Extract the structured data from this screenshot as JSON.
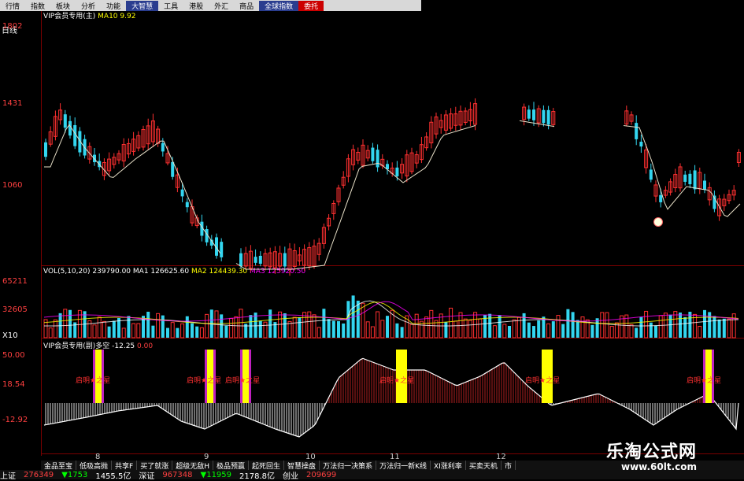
{
  "menu": [
    {
      "label": "行情",
      "style": ""
    },
    {
      "label": "指数",
      "style": ""
    },
    {
      "label": "板块",
      "style": ""
    },
    {
      "label": "分析",
      "style": ""
    },
    {
      "label": "功能",
      "style": ""
    },
    {
      "label": "大智慧",
      "style": "hl"
    },
    {
      "label": "工具",
      "style": ""
    },
    {
      "label": "港股",
      "style": ""
    },
    {
      "label": "外汇",
      "style": ""
    },
    {
      "label": "商品",
      "style": ""
    },
    {
      "label": "全球指数",
      "style": "hl"
    },
    {
      "label": "委托",
      "style": "red"
    }
  ],
  "main": {
    "period": "日线",
    "title": "VIP会员专用(主)",
    "ma_label": "MA10",
    "ma_value": "9.92",
    "y_ticks": [
      "1802",
      "1431",
      "1060"
    ]
  },
  "volume": {
    "title": "VOL(5,10,20)",
    "vol": "239790.00",
    "ma1": "MA1 126625.60",
    "ma2": "MA2 124439.30",
    "ma3": "MA3 125920.50",
    "y_ticks": [
      "65211",
      "32605"
    ],
    "unit": "X10"
  },
  "indicator": {
    "title": "VIP会员专用(副)多空",
    "value": "-12.25",
    "extra": "0.00",
    "y_ticks": [
      "50.00",
      "18.54",
      "-12.92"
    ],
    "signal_text": "启明★之星"
  },
  "x_labels": [
    "8",
    "9",
    "10",
    "11",
    "12"
  ],
  "tabs": [
    "金品至宝",
    "低吸高抛",
    "共享F",
    "买了就涨",
    "超级无敌H",
    "极品预赢",
    "起死回生",
    "智慧操盘",
    "万法归一决策系",
    "万法归一新K线",
    "XI涨利率",
    "买卖天机",
    "市"
  ],
  "status": {
    "market": "上证",
    "v1": "276349",
    "v2": "▼1753",
    "v3": "1455.5亿",
    "market2": "深证",
    "v4": "967348",
    "v5": "▼11959",
    "v6": "2178.8亿",
    "market3": "创业",
    "v7": "209699"
  },
  "watermark": {
    "cn": "乐淘公式网",
    "url": "www.60lt.com"
  },
  "colors": {
    "up": "#ff3030",
    "down": "#33d6f0",
    "ma": "#f0f0e0",
    "grid": "#7a0000"
  }
}
